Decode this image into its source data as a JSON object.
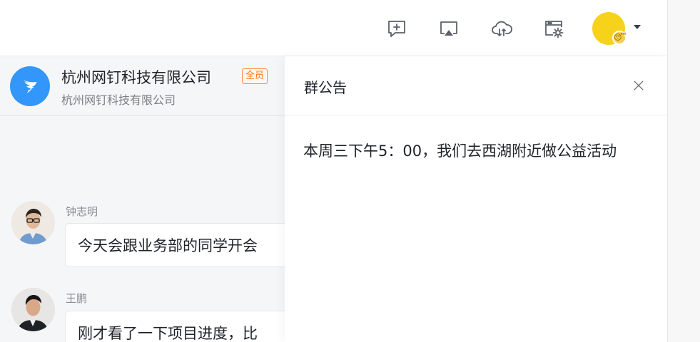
{
  "toolbar": {
    "icons": [
      {
        "name": "new-message-icon"
      },
      {
        "name": "screen-share-icon"
      },
      {
        "name": "cloud-drive-icon"
      },
      {
        "name": "workbench-settings-icon"
      }
    ],
    "avatar_badge": "😴",
    "colors": {
      "avatar": "#f7d21b",
      "icon": "#5a6069"
    }
  },
  "chat": {
    "group_title": "杭州网钉科技有限公司",
    "tag": "全员",
    "group_subtitle": "杭州网钉科技有限公司",
    "messages": [
      {
        "sender": "钟志明",
        "text": "今天会跟业务部的同学开会"
      },
      {
        "sender": "王鹏",
        "text": "刚才看了一下项目进度，比"
      }
    ]
  },
  "announcement": {
    "title": "群公告",
    "content": "本周三下午5：00，我们去西湖附近做公益活动"
  },
  "colors": {
    "brand": "#3296fa",
    "tag": "#ff7a22",
    "background": "#f5f6f7"
  }
}
